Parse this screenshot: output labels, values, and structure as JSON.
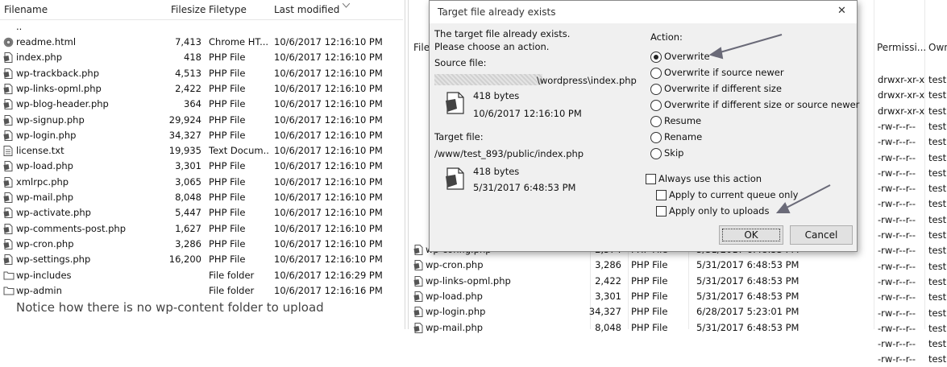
{
  "left_pane": {
    "columns": [
      "Filename",
      "Filesize",
      "Filetype",
      "Last modified"
    ],
    "parent_dir": "..",
    "rows": [
      {
        "name": "readme.html",
        "size": "7,413",
        "type": "Chrome HT...",
        "modified": "10/6/2017 12:16:10 PM",
        "icon": "chrome-file-icon"
      },
      {
        "name": "index.php",
        "size": "418",
        "type": "PHP File",
        "modified": "10/6/2017 12:16:10 PM",
        "icon": "php-file-icon"
      },
      {
        "name": "wp-trackback.php",
        "size": "4,513",
        "type": "PHP File",
        "modified": "10/6/2017 12:16:10 PM",
        "icon": "php-file-icon"
      },
      {
        "name": "wp-links-opml.php",
        "size": "2,422",
        "type": "PHP File",
        "modified": "10/6/2017 12:16:10 PM",
        "icon": "php-file-icon"
      },
      {
        "name": "wp-blog-header.php",
        "size": "364",
        "type": "PHP File",
        "modified": "10/6/2017 12:16:10 PM",
        "icon": "php-file-icon"
      },
      {
        "name": "wp-signup.php",
        "size": "29,924",
        "type": "PHP File",
        "modified": "10/6/2017 12:16:10 PM",
        "icon": "php-file-icon"
      },
      {
        "name": "wp-login.php",
        "size": "34,327",
        "type": "PHP File",
        "modified": "10/6/2017 12:16:10 PM",
        "icon": "php-file-icon"
      },
      {
        "name": "license.txt",
        "size": "19,935",
        "type": "Text Docum...",
        "modified": "10/6/2017 12:16:10 PM",
        "icon": "text-file-icon"
      },
      {
        "name": "wp-load.php",
        "size": "3,301",
        "type": "PHP File",
        "modified": "10/6/2017 12:16:10 PM",
        "icon": "php-file-icon"
      },
      {
        "name": "xmlrpc.php",
        "size": "3,065",
        "type": "PHP File",
        "modified": "10/6/2017 12:16:10 PM",
        "icon": "php-file-icon"
      },
      {
        "name": "wp-mail.php",
        "size": "8,048",
        "type": "PHP File",
        "modified": "10/6/2017 12:16:10 PM",
        "icon": "php-file-icon"
      },
      {
        "name": "wp-activate.php",
        "size": "5,447",
        "type": "PHP File",
        "modified": "10/6/2017 12:16:10 PM",
        "icon": "php-file-icon"
      },
      {
        "name": "wp-comments-post.php",
        "size": "1,627",
        "type": "PHP File",
        "modified": "10/6/2017 12:16:10 PM",
        "icon": "php-file-icon"
      },
      {
        "name": "wp-cron.php",
        "size": "3,286",
        "type": "PHP File",
        "modified": "10/6/2017 12:16:10 PM",
        "icon": "php-file-icon"
      },
      {
        "name": "wp-settings.php",
        "size": "16,200",
        "type": "PHP File",
        "modified": "10/6/2017 12:16:10 PM",
        "icon": "php-file-icon"
      },
      {
        "name": "wp-includes",
        "size": "",
        "type": "File folder",
        "modified": "10/6/2017 12:16:29 PM",
        "icon": "folder-icon"
      },
      {
        "name": "wp-admin",
        "size": "",
        "type": "File folder",
        "modified": "10/6/2017 12:16:16 PM",
        "icon": "folder-icon"
      }
    ],
    "annotation": "Notice how there is no wp-content folder to upload"
  },
  "right_pane": {
    "header_partial": "File",
    "col_permissions": "Permissi...",
    "col_owner": "Own",
    "perm_rows": [
      {
        "perm": "drwxr-xr-x",
        "owner": "test"
      },
      {
        "perm": "drwxr-xr-x",
        "owner": "test"
      },
      {
        "perm": "drwxr-xr-x",
        "owner": "test"
      },
      {
        "perm": "-rw-r--r--",
        "owner": "test"
      },
      {
        "perm": "-rw-r--r--",
        "owner": "test"
      },
      {
        "perm": "-rw-r--r--",
        "owner": "test"
      },
      {
        "perm": "-rw-r--r--",
        "owner": "test"
      },
      {
        "perm": "-rw-r--r--",
        "owner": "test"
      },
      {
        "perm": "-rw-r--r--",
        "owner": "test"
      },
      {
        "perm": "-rw-r--r--",
        "owner": "test"
      },
      {
        "perm": "-rw-r--r--",
        "owner": "test"
      },
      {
        "perm": "-rw-r--r--",
        "owner": "test"
      },
      {
        "perm": "-rw-r--r--",
        "owner": "test"
      },
      {
        "perm": "-rw-r--r--",
        "owner": "test"
      },
      {
        "perm": "-rw-r--r--",
        "owner": "test"
      },
      {
        "perm": "-rw-r--r--",
        "owner": "test"
      },
      {
        "perm": "-rw-r--r--",
        "owner": "test"
      },
      {
        "perm": "-rw-r--r--",
        "owner": "test"
      },
      {
        "perm": "-rw-r--r--",
        "owner": "test"
      }
    ],
    "rows": [
      {
        "name": "wp-config.php",
        "size": "2,574",
        "type": "PHP File",
        "modified": "5/31/2017 6:48:53 PM"
      },
      {
        "name": "wp-cron.php",
        "size": "3,286",
        "type": "PHP File",
        "modified": "5/31/2017 6:48:53 PM"
      },
      {
        "name": "wp-links-opml.php",
        "size": "2,422",
        "type": "PHP File",
        "modified": "5/31/2017 6:48:53 PM"
      },
      {
        "name": "wp-load.php",
        "size": "3,301",
        "type": "PHP File",
        "modified": "5/31/2017 6:48:53 PM"
      },
      {
        "name": "wp-login.php",
        "size": "34,327",
        "type": "PHP File",
        "modified": "6/28/2017 5:23:01 PM"
      },
      {
        "name": "wp-mail.php",
        "size": "8,048",
        "type": "PHP File",
        "modified": "5/31/2017 6:48:53 PM"
      }
    ]
  },
  "dialog": {
    "title": "Target file already exists",
    "close_glyph": "✕",
    "message_line1": "The target file already exists.",
    "message_line2": "Please choose an action.",
    "source_label": "Source file:",
    "source_path": "\\wordpress\\index.php",
    "source_size": "418 bytes",
    "source_date": "10/6/2017 12:16:10 PM",
    "target_label": "Target file:",
    "target_path": "/www/test_893/public/index.php",
    "target_size": "418 bytes",
    "target_date": "5/31/2017 6:48:53 PM",
    "action_label": "Action:",
    "options": [
      {
        "label": "Overwrite",
        "selected": true
      },
      {
        "label": "Overwrite if source newer",
        "selected": false
      },
      {
        "label": "Overwrite if different size",
        "selected": false
      },
      {
        "label": "Overwrite if different size or source newer",
        "selected": false
      },
      {
        "label": "Resume",
        "selected": false
      },
      {
        "label": "Rename",
        "selected": false
      },
      {
        "label": "Skip",
        "selected": false
      }
    ],
    "always_use_label": "Always use this action",
    "apply_queue_label": "Apply to current queue only",
    "apply_uploads_label": "Apply only to uploads",
    "ok_label": "OK",
    "cancel_label": "Cancel"
  },
  "colors": {
    "arrow": "#6a6a78",
    "dialog_bg": "#f0f0f0",
    "redaction": "#c8c8c8"
  }
}
